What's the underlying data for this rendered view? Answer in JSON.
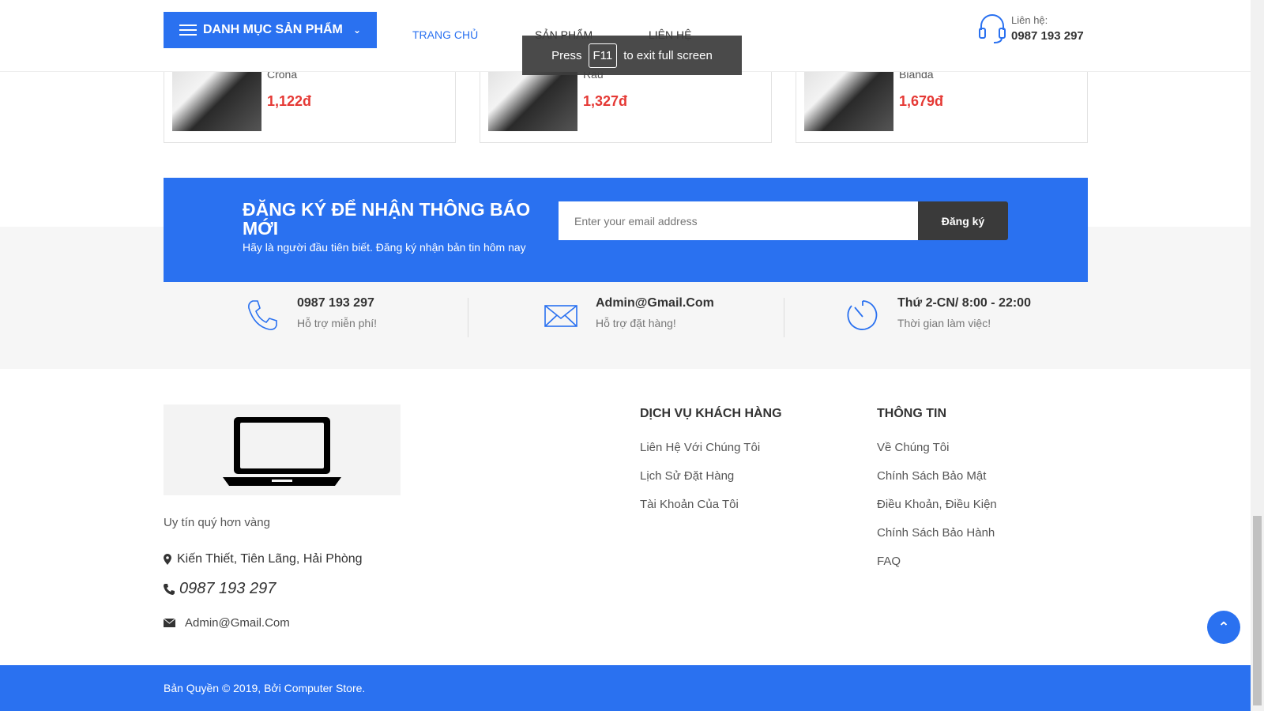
{
  "header": {
    "category_button": "DANH MỤC SẢN PHẨM",
    "nav": [
      "TRANG CHỦ",
      "SẢN PHẨM",
      "LIÊN HỆ"
    ],
    "hotline_label": "Liên hệ:",
    "hotline_number": "0987 193 297"
  },
  "toast": {
    "press": "Press",
    "key": "F11",
    "rest": "to exit full screen"
  },
  "products": [
    {
      "name": "Crona",
      "price": "1,122đ"
    },
    {
      "name": "Rau",
      "price": "1,327đ"
    },
    {
      "name": "Bianda",
      "price": "1,679đ"
    }
  ],
  "newsletter": {
    "title": "ĐĂNG KÝ ĐỂ NHẬN THÔNG BÁO MỚI",
    "subtitle": "Hãy là người đầu tiên biết. Đăng ký nhận bản tin hôm nay",
    "placeholder": "Enter your email address",
    "button": "Đăng ký"
  },
  "info": [
    {
      "title": "0987 193 297",
      "sub": "Hỗ trợ miễn phí!"
    },
    {
      "title": "Admin@Gmail.Com",
      "sub": "Hỗ trợ đặt hàng!"
    },
    {
      "title": "Thứ 2-CN/ 8:00 - 22:00",
      "sub": "Thời gian làm việc!"
    }
  ],
  "footer": {
    "slogan": "Uy tín quý hơn vàng",
    "address": "Kiến Thiết, Tiên Lãng, Hải Phòng",
    "phone": "0987 193 297",
    "email": "Admin@Gmail.Com",
    "service_title": "DỊCH VỤ KHÁCH HÀNG",
    "service_links": [
      "Liên Hệ Với Chúng Tôi",
      "Lịch Sử Đặt Hàng",
      "Tài Khoản Của Tôi"
    ],
    "info_title": "THÔNG TIN",
    "info_links": [
      "Về Chúng Tôi",
      "Chính Sách Bảo Mật",
      "Điều Khoản, Điều Kiện",
      "Chính Sách Bảo Hành",
      "FAQ"
    ],
    "copyright": "Bản Quyền © 2019, Bởi Computer Store."
  },
  "colors": {
    "primary": "#2a71f0",
    "price": "#e53935",
    "dark_button": "#3a3a3a"
  }
}
